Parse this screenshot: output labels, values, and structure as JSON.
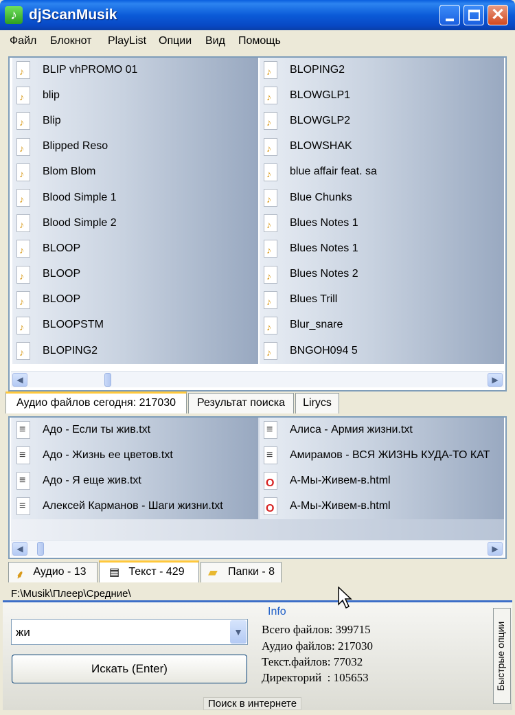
{
  "window": {
    "title": "djScanMusik"
  },
  "menu": [
    "Файл",
    "Блокнот",
    "PlayList",
    "Опции",
    "Вид",
    "Помощь"
  ],
  "audio_list": {
    "left": [
      "BLIP vhPROMO 01",
      "blip",
      "Blip",
      "Blipped Reso",
      "Blom Blom",
      "Blood Simple 1",
      "Blood Simple 2",
      "BLOOP",
      "BLOOP",
      "BLOOP",
      "BLOOPSTM",
      "BLOPING2"
    ],
    "right": [
      "BLOPING2",
      "BLOWGLP1",
      "BLOWGLP2",
      "BLOWSHAK",
      "blue affair feat. sa",
      "Blue Chunks",
      "Blues Notes 1",
      "Blues Notes 1",
      "Blues Notes 2",
      "Blues Trill",
      "Blur_snare",
      "BNGOH094 5"
    ]
  },
  "upper_tabs": [
    "Аудио файлов сегодня: 217030",
    "Результат поиска",
    "Lirycs"
  ],
  "text_list": {
    "left": [
      "Адо - Если ты жив.txt",
      "Адо - Жизнь ее цветов.txt",
      "Адо - Я еще жив.txt",
      "Алексей Карманов - Шаги жизни.txt"
    ],
    "right": [
      {
        "name": "Алиса - Армия жизни.txt",
        "icon": "doc"
      },
      {
        "name": "Амирамов - ВСЯ ЖИЗНЬ КУДА-ТО КАТ",
        "icon": "doc"
      },
      {
        "name": "А-Мы-Живем-в.html",
        "icon": "opera"
      },
      {
        "name": "А-Мы-Живем-в.html",
        "icon": "opera"
      }
    ]
  },
  "lower_tabs": [
    "Аудио - 13",
    "Текст - 429",
    "Папки - 8"
  ],
  "path": "F:\\Musik\\Плеер\\Средние\\",
  "search": {
    "value": "жи",
    "button": "Искать (Enter)"
  },
  "info": {
    "title": "Info",
    "lines": [
      "Всего файлов: 399715",
      "Аудио файлов: 217030",
      "Текст.файлов: 77032",
      "Директорий  : 105653"
    ]
  },
  "side_tab": "Быстрые опции",
  "web_search": "Поиск в интернете"
}
